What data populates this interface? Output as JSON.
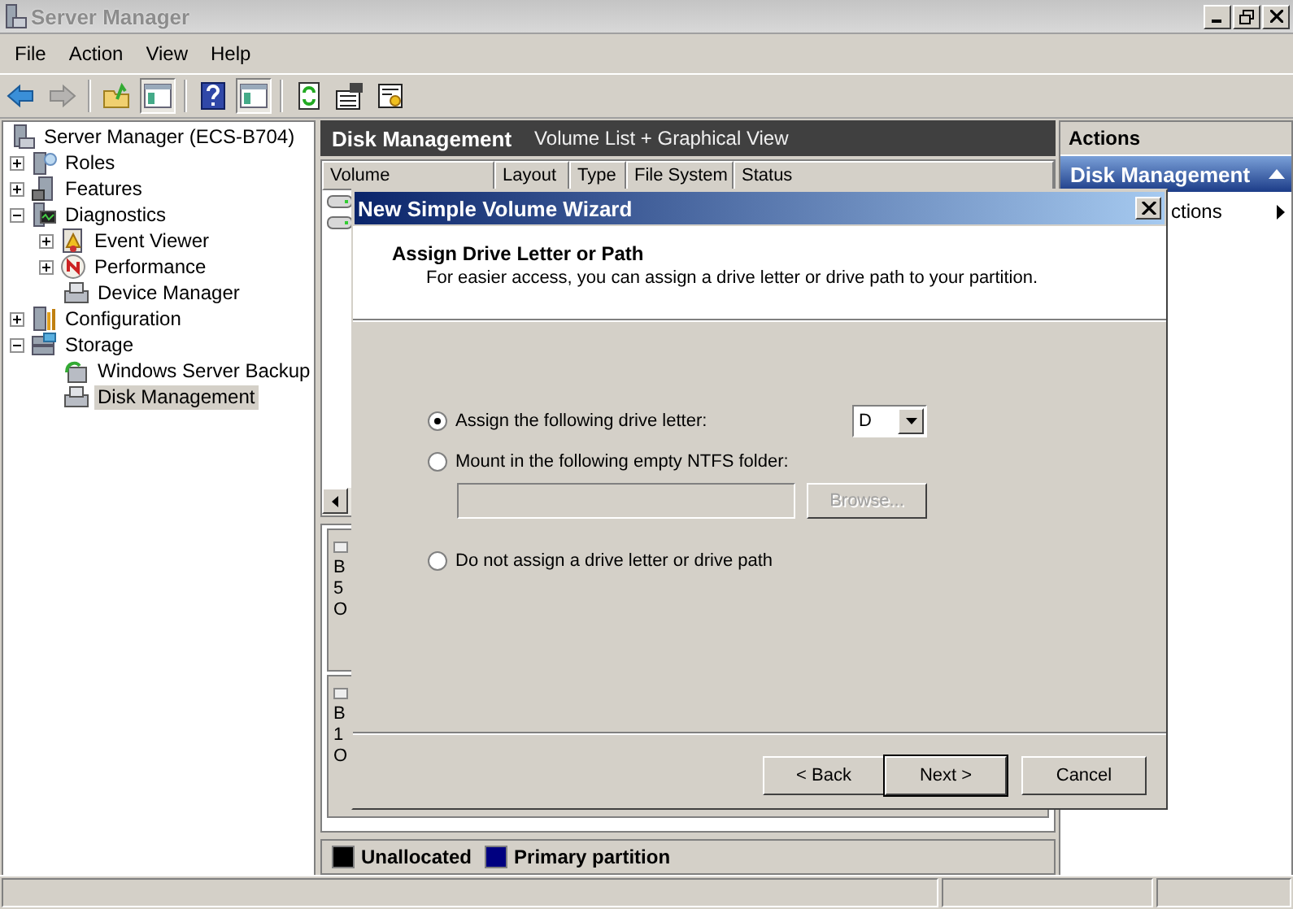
{
  "window": {
    "title": "Server Manager"
  },
  "menu": [
    "File",
    "Action",
    "View",
    "Help"
  ],
  "toolbar": [
    {
      "kind": "back",
      "disabled": false,
      "on": false
    },
    {
      "kind": "forward",
      "disabled": true,
      "on": false
    },
    {
      "kind": "up",
      "disabled": false,
      "on": false
    },
    {
      "kind": "pane",
      "disabled": false,
      "on": true
    },
    {
      "kind": "help",
      "disabled": false,
      "on": false
    },
    {
      "kind": "pane",
      "disabled": false,
      "on": true
    },
    {
      "kind": "refresh",
      "disabled": false,
      "on": false
    },
    {
      "kind": "properties",
      "disabled": false,
      "on": false
    },
    {
      "kind": "export",
      "disabled": false,
      "on": false
    }
  ],
  "tree": [
    {
      "label": "Server Manager (ECS-B704)",
      "kind": "server",
      "selected": false,
      "children": [
        {
          "label": "Roles",
          "kind": "roles",
          "expanded": false,
          "selected": false
        },
        {
          "label": "Features",
          "kind": "features",
          "expanded": false,
          "selected": false
        },
        {
          "label": "Diagnostics",
          "kind": "diagnostics",
          "expanded": true,
          "selected": false,
          "children": [
            {
              "label": "Event Viewer",
              "kind": "events",
              "expanded": false,
              "selected": false
            },
            {
              "label": "Performance",
              "kind": "performance",
              "expanded": false,
              "selected": false
            },
            {
              "label": "Device Manager",
              "kind": "device",
              "selected": false
            }
          ]
        },
        {
          "label": "Configuration",
          "kind": "configuration",
          "expanded": false,
          "selected": false
        },
        {
          "label": "Storage",
          "kind": "storage",
          "expanded": true,
          "selected": false,
          "children": [
            {
              "label": "Windows Server Backup",
              "kind": "backup",
              "selected": false
            },
            {
              "label": "Disk Management",
              "kind": "device",
              "selected": true
            }
          ]
        }
      ]
    }
  ],
  "center": {
    "title": "Disk Management",
    "subtitle": "Volume List + Graphical View",
    "columns": [
      "Volume",
      "Layout",
      "Type",
      "File System",
      "Status"
    ],
    "volumes": [
      {
        "kind": "drive"
      },
      {
        "kind": "drive"
      }
    ],
    "disks": [
      {
        "lines": [
          "B",
          "5",
          "O"
        ]
      },
      {
        "lines": [
          "B",
          "1",
          "O"
        ]
      }
    ],
    "legend": [
      {
        "label": "Unallocated",
        "color": "#000000"
      },
      {
        "label": "Primary partition",
        "color": "#000080"
      }
    ]
  },
  "actions": {
    "title": "Actions",
    "section": "Disk Management",
    "expanded": true,
    "items": [
      {
        "label": "ctions",
        "submenu": true
      }
    ]
  },
  "dialog": {
    "title": "New Simple Volume Wizard",
    "heading": "Assign Drive Letter or Path",
    "description": "For easier access, you can assign a drive letter or drive path to your partition.",
    "options": [
      {
        "kind": "letter",
        "label": "Assign the following drive letter:",
        "selected": true
      },
      {
        "kind": "folder",
        "label": "Mount in the following empty NTFS folder:",
        "selected": false
      },
      {
        "kind": "none",
        "label": "Do not assign a drive letter or drive path",
        "selected": false
      }
    ],
    "drive_letter": "D",
    "browse": {
      "label": "Browse...",
      "disabled": true
    },
    "buttons": [
      {
        "label": "< Back",
        "default": false
      },
      {
        "label": "Next >",
        "default": true
      },
      {
        "label": "Cancel",
        "default": false
      }
    ]
  }
}
